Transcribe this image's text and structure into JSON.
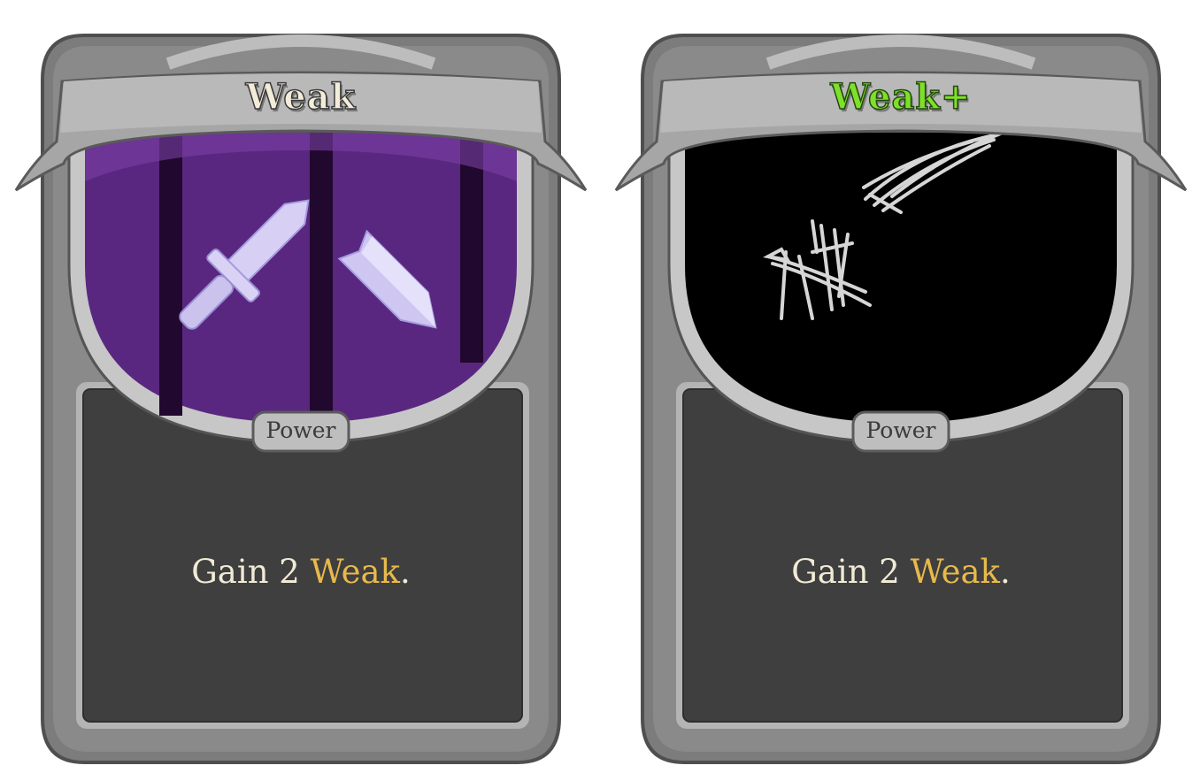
{
  "cards": [
    {
      "name": "Weak",
      "upgraded": false,
      "type": "Power",
      "description": {
        "prefix": "Gain 2 ",
        "keyword": "Weak",
        "suffix": "."
      },
      "art": "crossed-swords-icon",
      "art_background": "#5a2780"
    },
    {
      "name": "Weak+",
      "upgraded": true,
      "type": "Power",
      "description": {
        "prefix": "Gain 2 ",
        "keyword": "Weak",
        "suffix": "."
      },
      "art": "scribble-sketch-icon",
      "art_background": "#000000"
    }
  ],
  "colors": {
    "title_normal": "#f3ecd9",
    "title_upgraded": "#7fe02a",
    "keyword": "#e8b94a",
    "frame": "#7b7b7b",
    "text_panel": "#3f3f3f"
  }
}
